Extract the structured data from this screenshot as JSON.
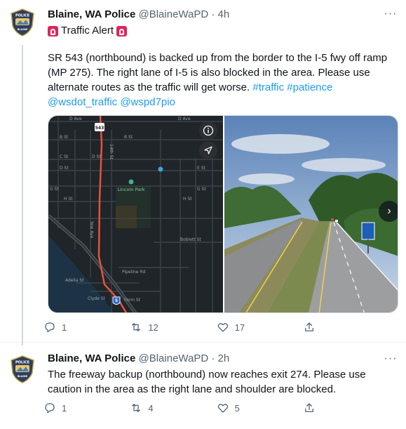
{
  "tweets": [
    {
      "name": "Blaine, WA Police",
      "handle": "@BlaineWaPD",
      "separator": "·",
      "time": "4h",
      "alert_text": "Traffic Alert",
      "text_main": "SR 543 (northbound) is backed up from the border to the I-5 fwy off ramp (MP 275). The right lane of I-5 is also blocked in the area. Please use alternate routes as the traffic will get worse.",
      "hashtags": [
        "#traffic",
        "#patience"
      ],
      "mentions": [
        "@wsdot_traffic",
        "@wspd7pio"
      ],
      "map_labels": {
        "d_ave": "D Ave",
        "b_st": "B St",
        "c_st": "C St",
        "d_st": "D St",
        "e_st": "E St",
        "g_st": "G St",
        "h_st": "H St",
        "park": "Lincoln Park",
        "boblett": "Boblett St",
        "pipeline": "Pipeline Rd",
        "adelia": "Adelia St",
        "clyde": "Clyde St",
        "ferm": "Ferm St",
        "shield_543": "543",
        "shield_5": "5",
        "yew": "Yew Ave",
        "fourteenth": "14th St"
      },
      "replies": "1",
      "retweets": "12",
      "likes": "17"
    },
    {
      "name": "Blaine, WA Police",
      "handle": "@BlaineWaPD",
      "separator": "·",
      "time": "2h",
      "text_main": "The freeway backup (northbound) now reaches exit 274. Please use caution in the area as the right lane and shoulder are blocked.",
      "replies": "1",
      "retweets": "4",
      "likes": "5"
    }
  ],
  "badge_text": "POLICE",
  "badge_sub": "BLAINE",
  "colors": {
    "link": "#1d9bf0",
    "secondary_text": "#536471",
    "siren": "#e0245e",
    "map_bg": "#1f2528",
    "route": "#e8523c"
  }
}
